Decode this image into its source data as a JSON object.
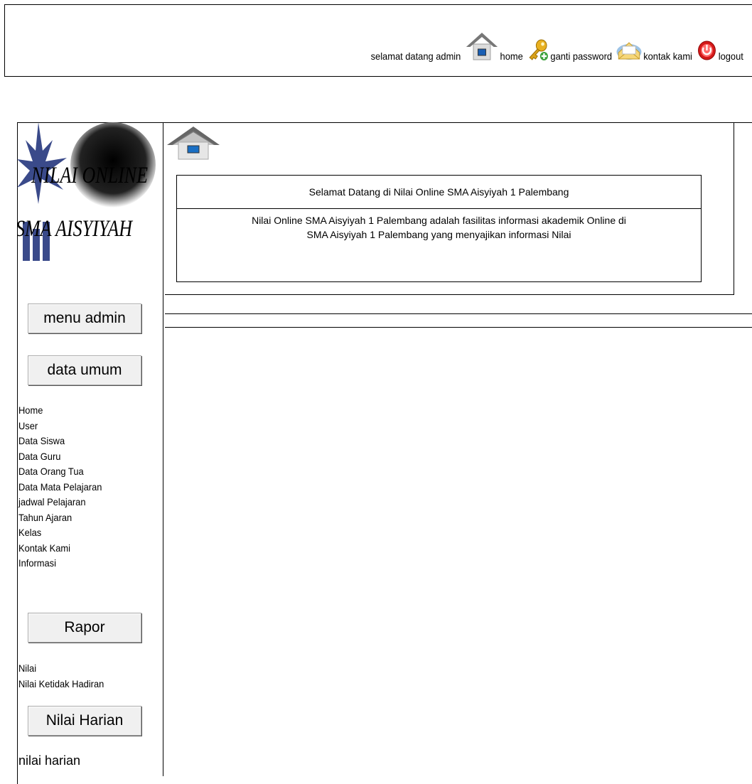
{
  "header": {
    "greeting": "selamat datang admin",
    "nav": [
      {
        "label": "home",
        "icon": "home-icon"
      },
      {
        "label": "ganti password",
        "icon": "key-icon"
      },
      {
        "label": "kontak kami",
        "icon": "envelope-icon"
      },
      {
        "label": "logout",
        "icon": "power-icon"
      }
    ]
  },
  "logo": {
    "line1": "NILAI ONLINE",
    "line2": "SMA AISYIYAH"
  },
  "sidebar": {
    "menu_admin": "menu admin",
    "data_umum": "data umum",
    "data_items": [
      "Home",
      "User",
      "Data Siswa",
      "Data Guru",
      "Data Orang Tua",
      "Data Mata Pelajaran",
      "jadwal Pelajaran",
      "Tahun Ajaran",
      "Kelas",
      "Kontak Kami",
      "Informasi"
    ],
    "rapor": "Rapor",
    "rapor_items": [
      "Nilai",
      "Nilai Ketidak Hadiran"
    ],
    "nilai_harian": "Nilai Harian",
    "nilai_harian_items": [
      "nilai harian"
    ]
  },
  "main": {
    "welcome_title": "Selamat Datang di Nilai Online SMA Aisyiyah 1 Palembang",
    "welcome_line1": "Nilai Online SMA Aisyiyah 1 Palembang adalah fasilitas informasi akademik Online di",
    "welcome_line2": "SMA Aisyiyah 1 Palembang yang menyajikan informasi Nilai"
  }
}
